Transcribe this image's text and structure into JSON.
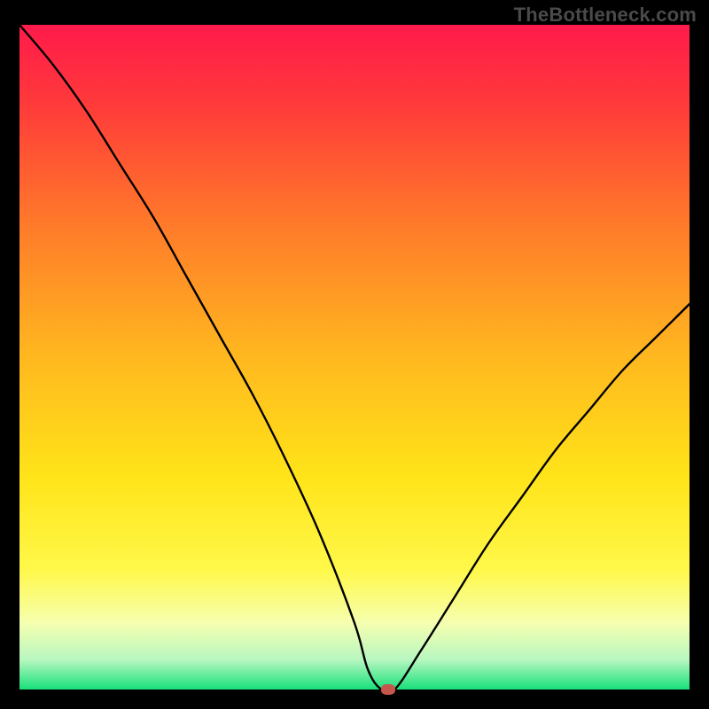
{
  "watermark": "TheBottleneck.com",
  "colors": {
    "frame": "#000000",
    "watermark": "#4a4a4a",
    "curve": "#000000",
    "marker": "#c5564b",
    "gradient_stops": [
      {
        "offset": 0.0,
        "color": "#ff1a4b"
      },
      {
        "offset": 0.12,
        "color": "#ff3a3a"
      },
      {
        "offset": 0.3,
        "color": "#ff7a2a"
      },
      {
        "offset": 0.5,
        "color": "#ffb81f"
      },
      {
        "offset": 0.68,
        "color": "#ffe419"
      },
      {
        "offset": 0.82,
        "color": "#fff84a"
      },
      {
        "offset": 0.9,
        "color": "#f6ffb0"
      },
      {
        "offset": 0.955,
        "color": "#b8f7c0"
      },
      {
        "offset": 1.0,
        "color": "#18e07a"
      }
    ]
  },
  "chart_data": {
    "type": "line",
    "title": "",
    "xlabel": "",
    "ylabel": "",
    "xlim": [
      0,
      100
    ],
    "ylim": [
      0,
      100
    ],
    "series": [
      {
        "name": "bottleneck-curve",
        "x": [
          0,
          5,
          10,
          15,
          20,
          25,
          30,
          35,
          40,
          45,
          50,
          52,
          54,
          56,
          60,
          65,
          70,
          75,
          80,
          85,
          90,
          95,
          100
        ],
        "y": [
          100,
          94,
          87,
          79,
          71,
          62,
          53,
          44,
          34,
          23,
          10,
          3,
          0,
          0,
          6,
          14,
          22,
          29,
          36,
          42,
          48,
          53,
          58
        ]
      }
    ],
    "floor_segment": {
      "x0": 52,
      "x1": 56,
      "y": 0
    },
    "marker": {
      "x": 55,
      "y": 0
    },
    "annotations": []
  }
}
